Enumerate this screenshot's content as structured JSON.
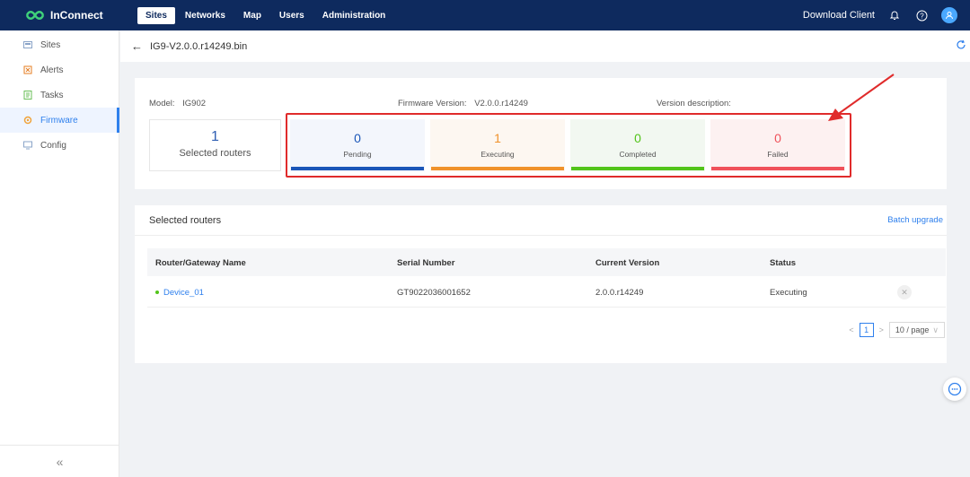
{
  "brand": {
    "name": "InConnect"
  },
  "topnav": {
    "items": [
      "Sites",
      "Networks",
      "Map",
      "Users",
      "Administration"
    ],
    "active": "Sites"
  },
  "topbar": {
    "download_client": "Download Client"
  },
  "sidebar": {
    "items": [
      {
        "label": "Sites",
        "icon": "sites-icon"
      },
      {
        "label": "Alerts",
        "icon": "alert-icon"
      },
      {
        "label": "Tasks",
        "icon": "tasks-icon"
      },
      {
        "label": "Firmware",
        "icon": "firmware-icon",
        "active": true
      },
      {
        "label": "Config",
        "icon": "config-icon"
      }
    ],
    "collapse_label": "«"
  },
  "page": {
    "title": "IG9-V2.0.0.r14249.bin"
  },
  "summary": {
    "model_label": "Model:",
    "model_value": "IG902",
    "fw_label": "Firmware Version:",
    "fw_value": "V2.0.0.r14249",
    "desc_label": "Version description:",
    "selected_count": "1",
    "selected_label": "Selected routers",
    "stats": [
      {
        "value": "0",
        "label": "Pending",
        "color": "#1a56b8",
        "bg": "#f3f6fc"
      },
      {
        "value": "1",
        "label": "Executing",
        "color": "#f0922b",
        "bg": "#fdf7f1"
      },
      {
        "value": "0",
        "label": "Completed",
        "color": "#52c41a",
        "bg": "#f2f8f1"
      },
      {
        "value": "0",
        "label": "Failed",
        "color": "#f0515a",
        "bg": "#fdf1f1"
      }
    ]
  },
  "routers": {
    "title": "Selected routers",
    "batch_upgrade": "Batch upgrade",
    "columns": [
      "Router/Gateway Name",
      "Serial Number",
      "Current Version",
      "Status"
    ],
    "rows": [
      {
        "name": "Device_01",
        "serial": "GT9022036001652",
        "version": "2.0.0.r14249",
        "status": "Executing"
      }
    ],
    "pagination": {
      "page": "1",
      "page_size": "10 / page"
    }
  },
  "colors": {
    "topbar": "#0e2a5e",
    "accent": "#2f80ed",
    "annotation": "#e02b2b"
  }
}
